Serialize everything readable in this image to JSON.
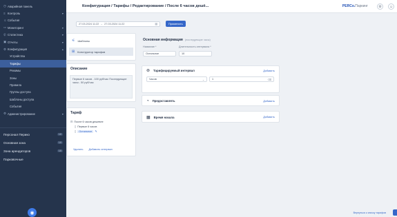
{
  "sidebar": {
    "items": [
      {
        "icon": "gauge-icon",
        "label": "Аварийная панель",
        "chevron": ""
      },
      {
        "icon": "list-icon",
        "label": "Контроль",
        "chevron": "▾"
      },
      {
        "icon": "user-icon",
        "label": "События",
        "chevron": ""
      },
      {
        "icon": "monitor-icon",
        "label": "Мониторинг",
        "chevron": "▾"
      },
      {
        "icon": "phone-icon",
        "label": "Статистика",
        "chevron": "▾"
      },
      {
        "icon": "lock-icon",
        "label": "Отчеты",
        "chevron": "▾"
      },
      {
        "icon": "gear-icon",
        "label": "Конфигурация",
        "chevron": "▴"
      }
    ],
    "sub_items": [
      "Устройства",
      "Тарифы",
      "Режимы",
      "Зоны",
      "Правила",
      "Группы доступа",
      "Шаблоны доступа",
      "События"
    ],
    "active_sub": 1,
    "admin": {
      "icon": "gear-icon",
      "label": "Администрирование",
      "chevron": "▾"
    },
    "big_items": [
      {
        "label": "Персонал Перико",
        "badge": "10"
      },
      {
        "label": "Основная зона",
        "badge": "10"
      },
      {
        "label": "Зона арендаторов",
        "badge": "10"
      },
      {
        "label": "Парковочные",
        "badge": ""
      }
    ]
  },
  "header": {
    "breadcrumbs": "Конфигурация / Тарифы / Редактирование / После 6 часов дешё...",
    "brand": "PERCo.",
    "brand_light": "Паркинг"
  },
  "toolbar": {
    "date_from": "27.03.2024 11:22",
    "date_to": "27.03.2024 11:22",
    "apply_label": "Применить"
  },
  "left_tabs": [
    {
      "icon": "sliders-icon",
      "label": "Шаблоны"
    },
    {
      "icon": "grid-icon",
      "label": "Конструктор тарифов"
    }
  ],
  "description": {
    "title": "Описание",
    "text": "Первые 6 часов - 100 руб/час Последующие часы - 50 руб/час"
  },
  "tariff": {
    "title": "Тариф",
    "tree": [
      {
        "label": "После 6 часов дешевле",
        "level": 0
      },
      {
        "label": "Первые 6 часов",
        "level": 1
      },
      {
        "label": "Остальное",
        "level": 1
      }
    ],
    "remove_label": "Удалить",
    "add_label": "Добавить интервал"
  },
  "main": {
    "title": "Основная информация",
    "hint": "(последующие часы)",
    "name_label": "Название *",
    "name_value": "Остальное",
    "interval_label": "Длительность интервала *",
    "interval_value": "10",
    "cards": [
      {
        "icon": "coin-icon",
        "title": "Тарифицируемый интервал",
        "add": "Добавить"
      },
      {
        "icon": "clock-icon",
        "title": "Предоставлять",
        "add": "Добавить"
      },
      {
        "icon": "calendar-icon",
        "title": "Время начала",
        "add": "Добавить"
      }
    ],
    "unit_value": "Часов",
    "rate_value": "1"
  },
  "footer": {
    "link": "Вернуться к списку тарифов"
  }
}
